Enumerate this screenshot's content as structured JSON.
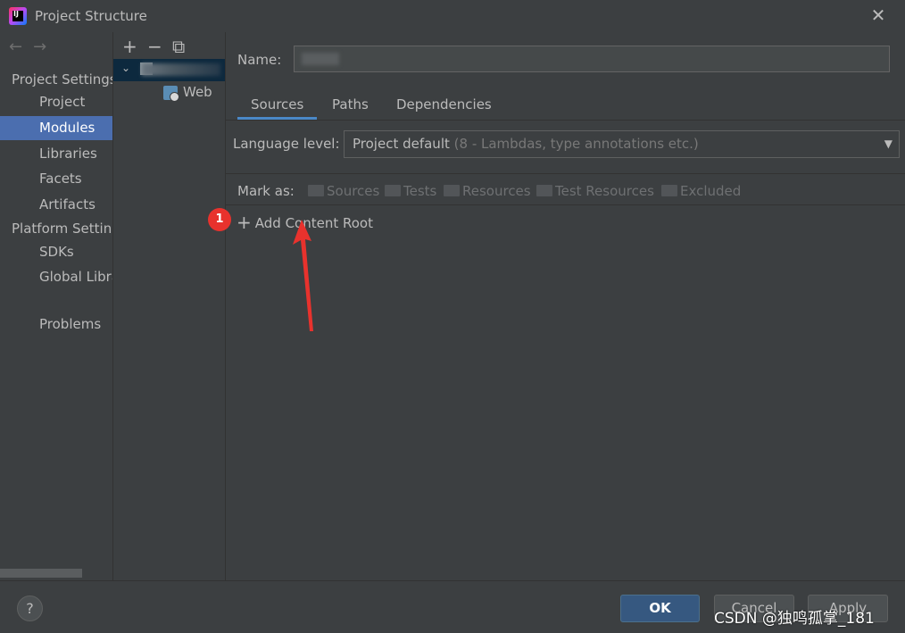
{
  "window": {
    "title": "Project Structure"
  },
  "nav": {
    "project_settings": "Project Settings",
    "platform_settings": "Platform Settings",
    "items": [
      "Project",
      "Modules",
      "Libraries",
      "Facets",
      "Artifacts",
      "SDKs",
      "Global Libraries",
      "Problems"
    ],
    "selected": "Modules"
  },
  "tree": {
    "child": "Web"
  },
  "main": {
    "name_label": "Name:",
    "tabs": [
      "Sources",
      "Paths",
      "Dependencies"
    ],
    "active_tab": "Sources",
    "language_label": "Language level:",
    "language_value": "Project default",
    "language_hint": "(8 - Lambdas, type annotations etc.)",
    "mark_label": "Mark as:",
    "mark_items": [
      "Sources",
      "Tests",
      "Resources",
      "Test Resources",
      "Excluded"
    ],
    "badge": "1",
    "add_content_root": "Add Content Root"
  },
  "buttons": {
    "ok": "OK",
    "cancel": "Cancel",
    "apply": "Apply",
    "help": "?"
  },
  "watermark": "CSDN @独鸣孤掌_181",
  "colors": {
    "accent": "#4b6eaf",
    "ok_button": "#365880",
    "badge": "#e8322d",
    "arrow": "#e8322d"
  }
}
